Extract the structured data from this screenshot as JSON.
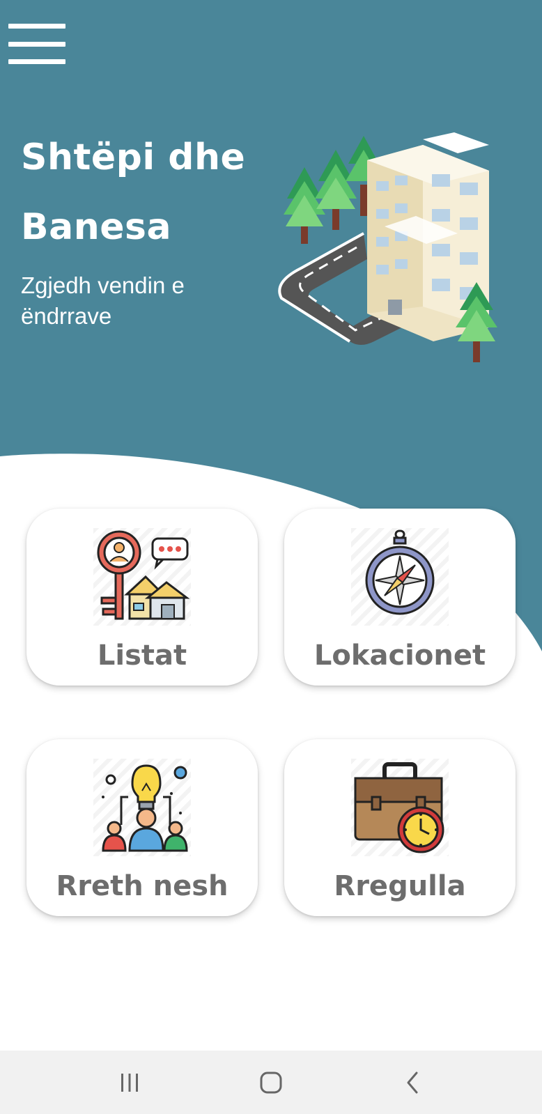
{
  "header": {
    "title_line1": "Shtëpi dhe",
    "title_line2": "Banesa",
    "subtitle": "Zgjedh vendin e ëndrrave"
  },
  "menu": {
    "icon": "hamburger-menu-icon"
  },
  "hero": {
    "icon": "city-building-road-illustration"
  },
  "cards": [
    {
      "label": "Listat",
      "icon": "key-house-search-icon"
    },
    {
      "label": "Lokacionet",
      "icon": "compass-icon"
    },
    {
      "label": "Rreth nesh",
      "icon": "team-idea-lightbulb-icon"
    },
    {
      "label": "Rregulla",
      "icon": "briefcase-clock-icon"
    }
  ],
  "navbar": {
    "recent_icon": "recent-apps-icon",
    "home_icon": "home-icon",
    "back_icon": "back-icon"
  },
  "colors": {
    "header_bg": "#4a8699",
    "card_label": "#6d6d6d",
    "navbar_bg": "#f1f1f1"
  }
}
